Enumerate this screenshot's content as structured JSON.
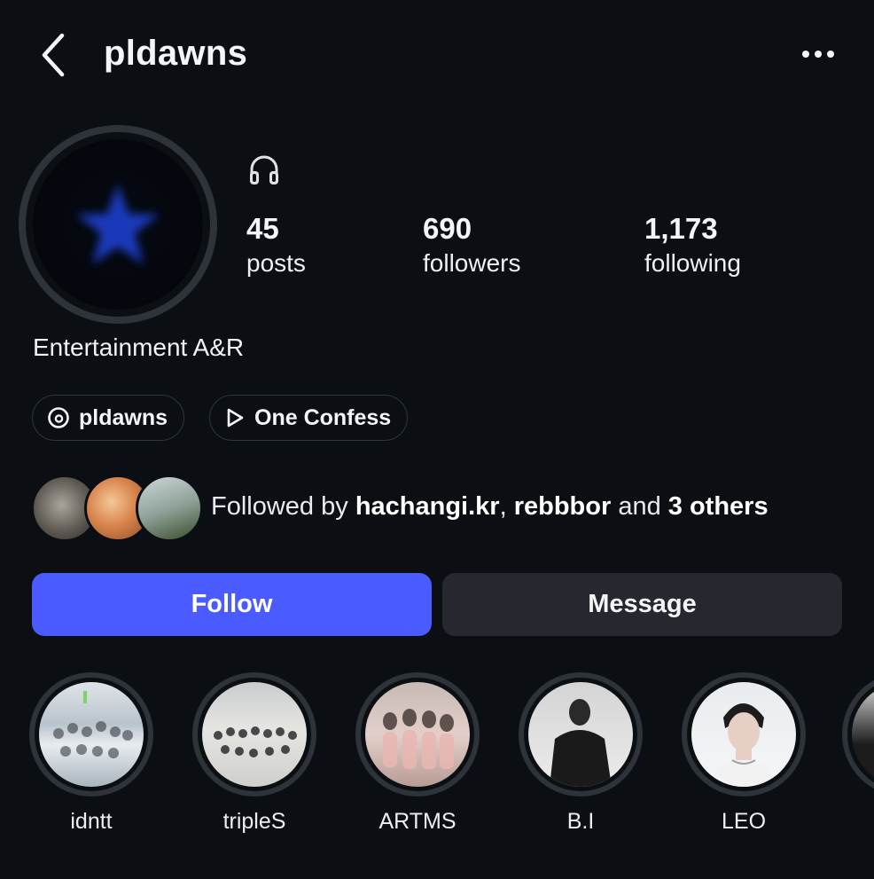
{
  "header": {
    "username": "pldawns"
  },
  "stats": [
    {
      "value": "45",
      "label": "posts"
    },
    {
      "value": "690",
      "label": "followers"
    },
    {
      "value": "1,173",
      "label": "following"
    }
  ],
  "bio": "Entertainment A&R",
  "chips": [
    {
      "label": "pldawns",
      "icon": "threads-icon"
    },
    {
      "label": "One Confess",
      "icon": "play-icon"
    }
  ],
  "followed_by": {
    "prefix": "Followed by ",
    "user1": "hachangi.kr",
    "sep": ", ",
    "user2": "rebbbor",
    "mid": " and ",
    "others": "3 others"
  },
  "buttons": {
    "follow": "Follow",
    "message": "Message"
  },
  "highlights": [
    {
      "label": "idntt"
    },
    {
      "label": "tripleS"
    },
    {
      "label": "ARTMS"
    },
    {
      "label": "B.I"
    },
    {
      "label": "LEO"
    }
  ],
  "colors": {
    "background": "#0b0f14",
    "follow_button": "#4a5cff",
    "message_button": "#25282e",
    "avatar_star": "#1b3dc4"
  }
}
